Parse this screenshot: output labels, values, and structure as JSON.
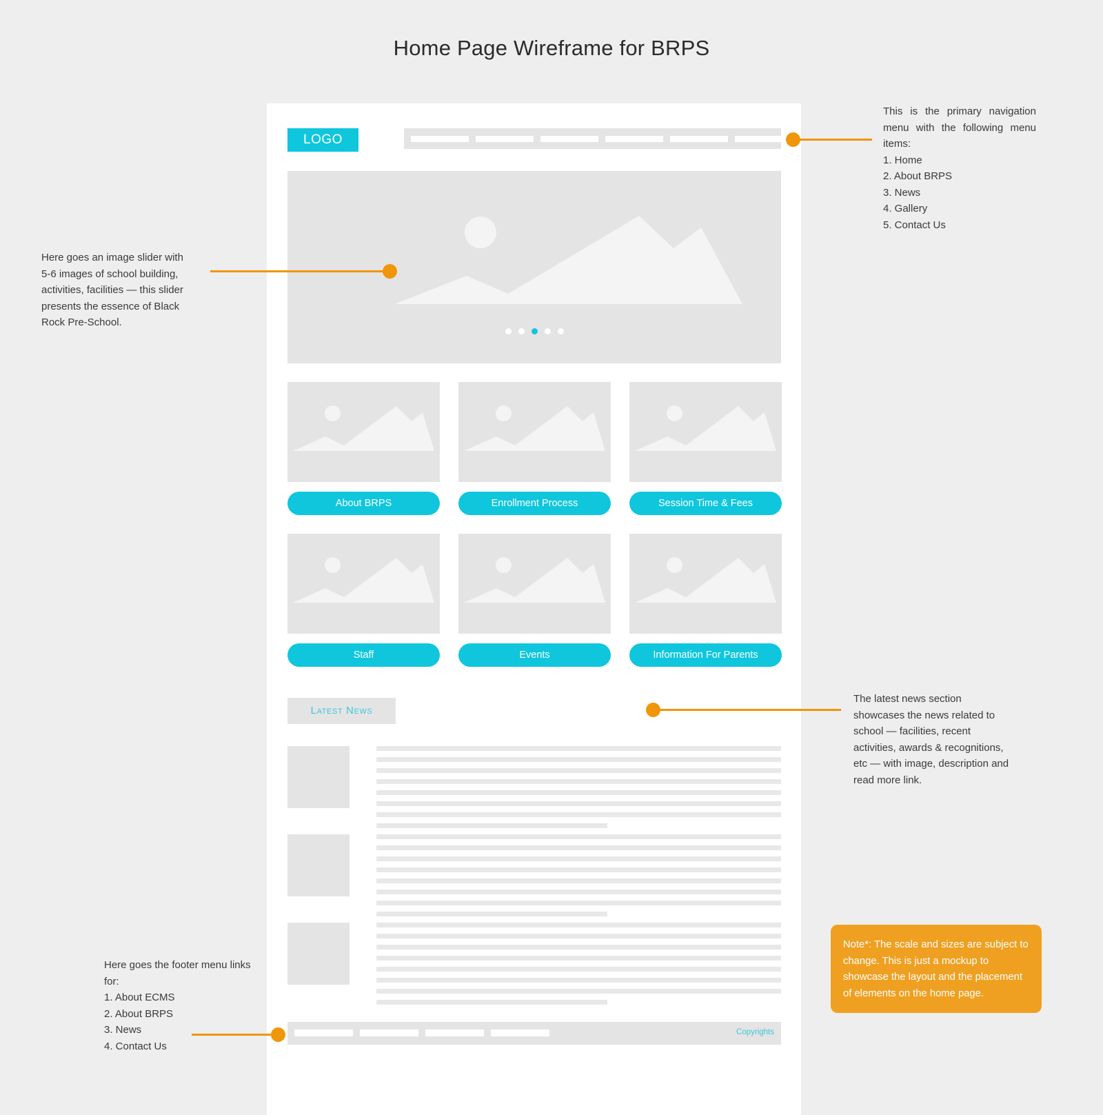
{
  "page_title": "Home Page Wireframe for BRPS",
  "wireframe": {
    "header": {
      "logo_label": "LOGO",
      "nav_placeholder_count": 6
    },
    "hero": {
      "slider_dot_count": 5,
      "active_dot_index": 2
    },
    "cards": [
      {
        "label": "About BRPS"
      },
      {
        "label": "Enrollment Process"
      },
      {
        "label": "Session Time & Fees"
      },
      {
        "label": "Staff"
      },
      {
        "label": "Events"
      },
      {
        "label": "Information For Parents"
      }
    ],
    "news": {
      "heading": "Latest News",
      "article_count": 3,
      "lines_per_article": 8
    },
    "footer": {
      "link_placeholder_count": 4,
      "copyrights_label": "Copyrights"
    }
  },
  "annotations": {
    "nav": {
      "text": "This is the primary navigation menu with the following menu items:",
      "items": [
        "1. Home",
        "2. About BRPS",
        "3. News",
        "4. Gallery",
        "5. Contact Us"
      ]
    },
    "slider": {
      "text": "Here goes an image slider with 5-6 images of school building, activities, facilities — this slider presents the essence of Black Rock Pre-School."
    },
    "news": {
      "text": "The latest news section showcases the news related to school — facilities, recent activities, awards & recognitions, etc — with image, description and read more link."
    },
    "footer": {
      "text": "Here goes the footer menu links for:",
      "items": [
        "1. About ECMS",
        "2. About BRPS",
        "3. News",
        "4. Contact Us"
      ]
    },
    "note": {
      "text": "Note*: The scale and sizes are subject to change. This is just a mockup to showcase the layout and the placement of elements on the home page."
    }
  },
  "colors": {
    "accent_cyan": "#0fc6dd",
    "accent_orange": "#f0960a",
    "note_orange": "#efa021",
    "placeholder_gray": "#e4e4e4",
    "page_background": "#eeeeee"
  }
}
